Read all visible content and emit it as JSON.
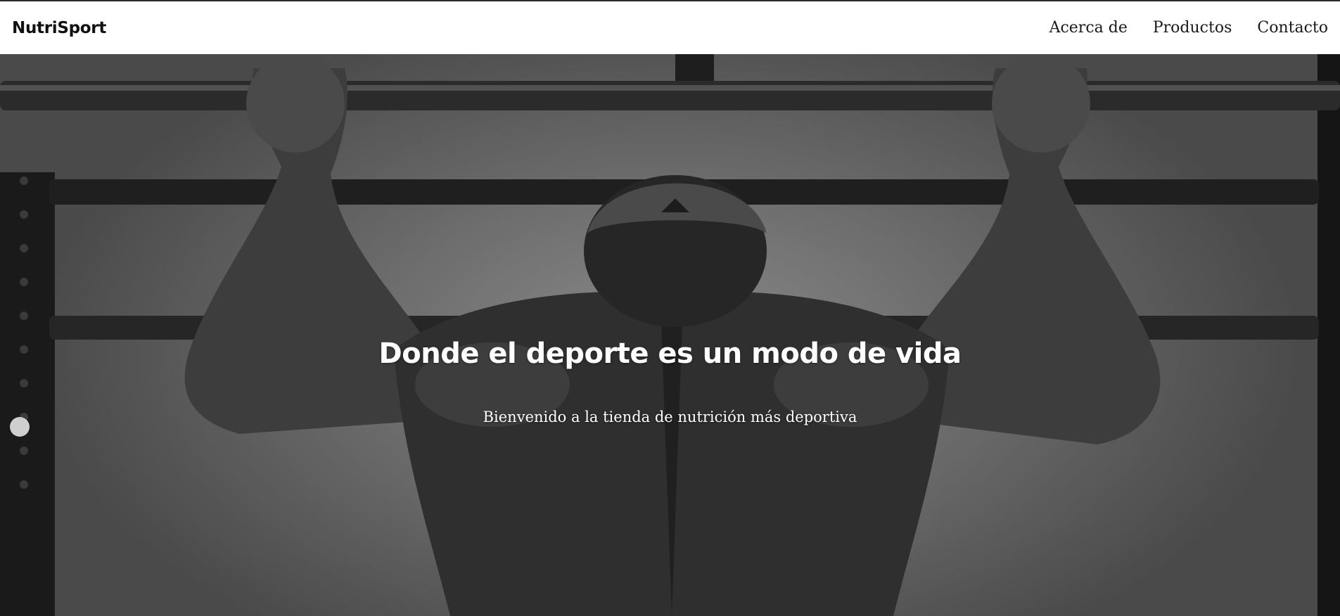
{
  "navbar": {
    "brand": "NutriSport",
    "links": [
      "Acerca de",
      "Productos",
      "Contacto"
    ]
  },
  "hero": {
    "title": "Donde el deporte es un modo de vida",
    "subtitle": "Bienvenido a la tienda de nutrición más deportiva",
    "image": "black-and-white-athlete-doing-pull-ups"
  },
  "colors": {
    "navbar_bg": "#ffffff",
    "text_dark": "#111111",
    "hero_text": "#ffffff"
  }
}
